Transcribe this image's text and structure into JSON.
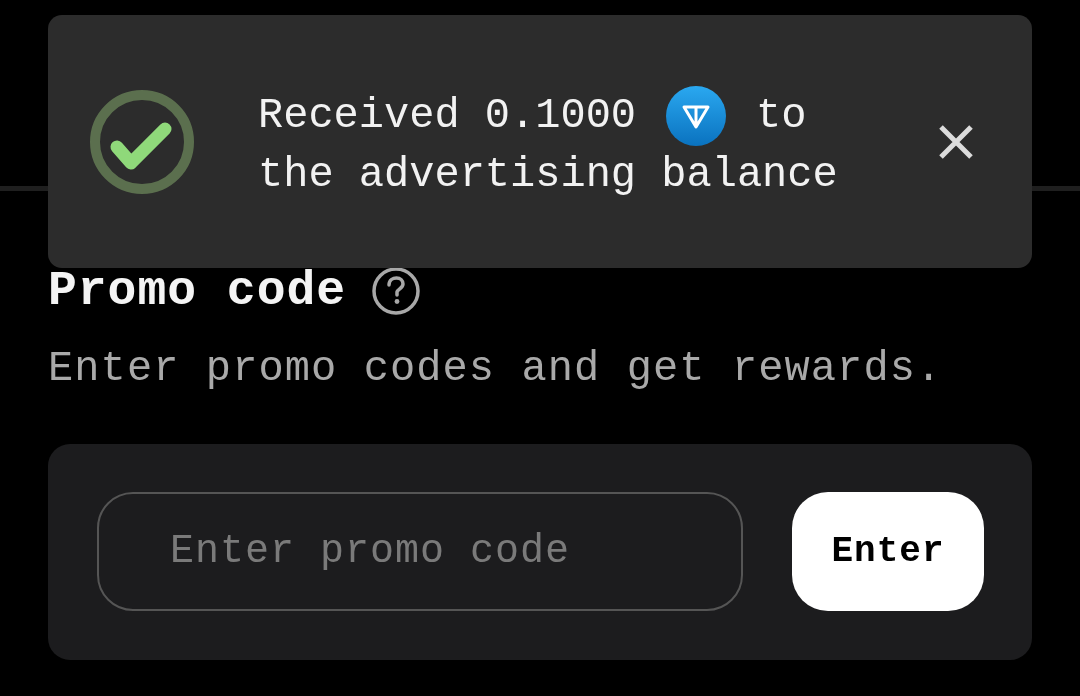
{
  "toast": {
    "lines": [
      {
        "parts": [
          {
            "kind": "text",
            "text": "Received 0.1000"
          },
          {
            "kind": "coin"
          },
          {
            "kind": "text",
            "text": "to"
          }
        ]
      },
      {
        "parts": [
          {
            "kind": "text",
            "text": "the advertising balance"
          }
        ]
      }
    ]
  },
  "promo": {
    "title": "Promo code",
    "description": "Enter promo codes and get rewards.",
    "input": {
      "placeholder": "Enter promo code"
    },
    "button": "Enter"
  }
}
